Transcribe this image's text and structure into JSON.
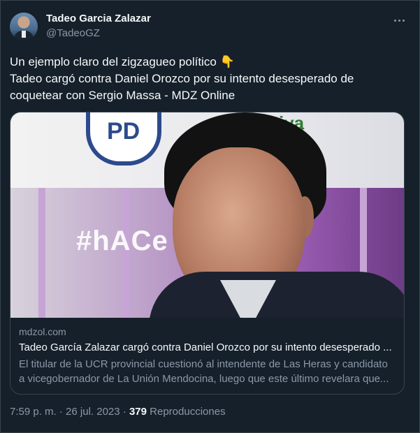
{
  "author": {
    "name": "Tadeo Garcia Zalazar",
    "handle": "@TadeoGZ"
  },
  "more_icon": "more-horizontal-icon",
  "tweet": {
    "line1": "Un ejemplo claro del zigzagueo político 👇",
    "line2": "Tadeo cargó contra Daniel Orozco por su intento desesperado de",
    "line3": "coquetear con Sergio Massa - MDZ Online"
  },
  "card": {
    "image_alt": "Photo of Tadeo García Zalazar in front of a branded backdrop",
    "backdrop_text": "#hACe",
    "backdrop_logo": "PD",
    "backdrop_green_text": "iva",
    "domain": "mdzol.com",
    "title": "Tadeo García Zalazar cargó contra Daniel Orozco por su intento desesperado ...",
    "desc_line1": "El titular de la UCR provincial cuestionó al intendente de Las Heras y candidato",
    "desc_line2": "a vicegobernador de La Unión Mendocina, luego que este último revelara que..."
  },
  "meta": {
    "time": "7:59 p. m.",
    "sep1": " · ",
    "date": "26 jul. 2023",
    "sep2": " · ",
    "views": "379",
    "views_label": " Reproducciones"
  },
  "colors": {
    "background": "#15202b",
    "text": "#f7f9f9",
    "secondary": "#8b98a5",
    "border": "#38444d"
  }
}
